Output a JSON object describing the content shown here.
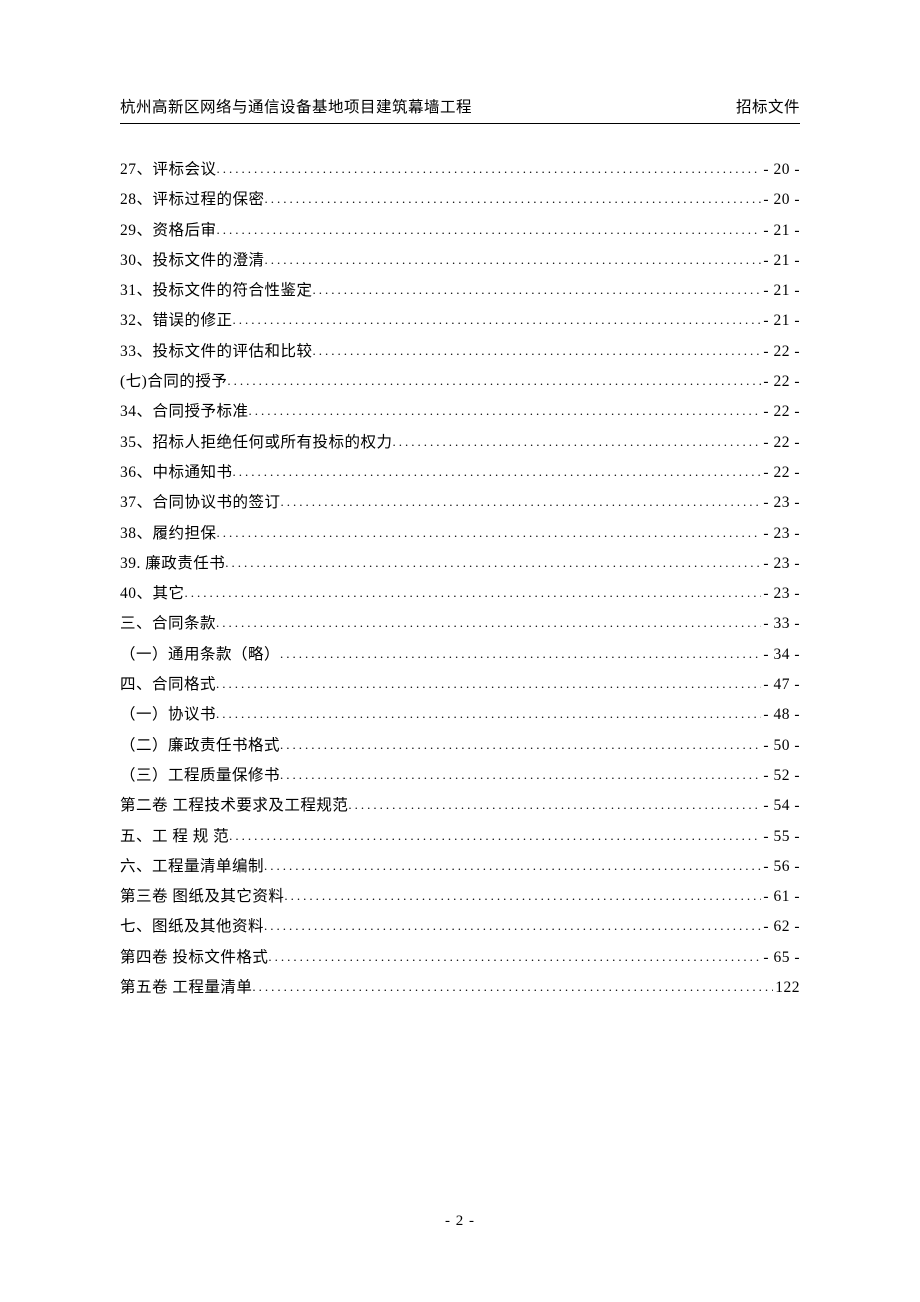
{
  "header": {
    "left": "杭州高新区网络与通信设备基地项目建筑幕墙工程",
    "right": "招标文件"
  },
  "toc": [
    {
      "label": "27、评标会议",
      "page": "- 20 -"
    },
    {
      "label": "28、评标过程的保密",
      "page": "- 20 -"
    },
    {
      "label": "29、资格后审",
      "page": "- 21 -"
    },
    {
      "label": "30、投标文件的澄清",
      "page": "- 21 -"
    },
    {
      "label": "31、投标文件的符合性鉴定",
      "page": "- 21 -"
    },
    {
      "label": "32、错误的修正",
      "page": "- 21 -"
    },
    {
      "label": "33、投标文件的评估和比较",
      "page": "- 22 -"
    },
    {
      "label": "(七)合同的授予",
      "page": "- 22 -"
    },
    {
      "label": "34、合同授予标准",
      "page": "- 22 -"
    },
    {
      "label": "35、招标人拒绝任何或所有投标的权力",
      "page": "- 22 -"
    },
    {
      "label": "36、中标通知书",
      "page": "- 22 -"
    },
    {
      "label": "37、合同协议书的签订",
      "page": "- 23 -"
    },
    {
      "label": "38、履约担保",
      "page": "- 23 -"
    },
    {
      "label": "39. 廉政责任书",
      "page": "- 23 -"
    },
    {
      "label": "40、其它",
      "page": "- 23 -"
    },
    {
      "label": "三、合同条款",
      "page": "- 33 -"
    },
    {
      "label": "（一）通用条款（略）",
      "page": "- 34 -"
    },
    {
      "label": "四、合同格式",
      "page": "- 47 -"
    },
    {
      "label": "（一）协议书",
      "page": "- 48 -"
    },
    {
      "label": "（二）廉政责任书格式",
      "page": "- 50 -"
    },
    {
      "label": "（三）工程质量保修书",
      "page": "- 52 -"
    },
    {
      "label": "第二卷  工程技术要求及工程规范",
      "page": "- 54 -"
    },
    {
      "label": "五、工 程 规 范",
      "page": "- 55 -"
    },
    {
      "label": "六、工程量清单编制",
      "page": "- 56 -"
    },
    {
      "label": "第三卷  图纸及其它资料",
      "page": "- 61 -"
    },
    {
      "label": "七、图纸及其他资料",
      "page": "- 62 -"
    },
    {
      "label": "第四卷   投标文件格式",
      "page": "- 65 -"
    },
    {
      "label": "第五卷  工程量清单",
      "page": "122"
    }
  ],
  "footer": {
    "page_number": "- 2 -"
  }
}
